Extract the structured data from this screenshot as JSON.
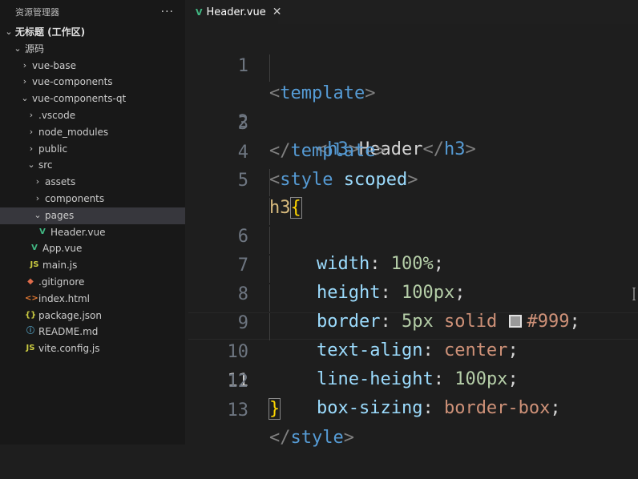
{
  "explorer": {
    "title": "资源管理器",
    "more": "···",
    "workspace": "无标题 (工作区)",
    "root_folder": "源码",
    "items": [
      {
        "label": "vue-base",
        "type": "folder",
        "expanded": false
      },
      {
        "label": "vue-components",
        "type": "folder",
        "expanded": false
      },
      {
        "label": "vue-components-qt",
        "type": "folder",
        "expanded": true
      },
      {
        "label": ".vscode",
        "type": "folder",
        "expanded": false
      },
      {
        "label": "node_modules",
        "type": "folder",
        "expanded": false
      },
      {
        "label": "public",
        "type": "folder",
        "expanded": false
      },
      {
        "label": "src",
        "type": "folder",
        "expanded": true
      },
      {
        "label": "assets",
        "type": "folder",
        "expanded": false
      },
      {
        "label": "components",
        "type": "folder",
        "expanded": false
      },
      {
        "label": "pages",
        "type": "folder",
        "expanded": true
      },
      {
        "label": "Header.vue",
        "type": "vue"
      },
      {
        "label": "App.vue",
        "type": "vue"
      },
      {
        "label": "main.js",
        "type": "js"
      },
      {
        "label": ".gitignore",
        "type": "git"
      },
      {
        "label": "index.html",
        "type": "html"
      },
      {
        "label": "package.json",
        "type": "json"
      },
      {
        "label": "README.md",
        "type": "info"
      },
      {
        "label": "vite.config.js",
        "type": "js"
      }
    ]
  },
  "icons": {
    "chevron_down": "chevron-down-icon",
    "chevron_right": "chevron-right-icon",
    "vue": "vue-file-icon",
    "js": "js-file-icon",
    "git": "git-file-icon",
    "html": "html-file-icon",
    "json": "json-file-icon",
    "info": "info-file-icon"
  },
  "icon_glyphs": {
    "chevron_down": "⌄",
    "chevron_right": "›",
    "vue": "V",
    "js": "JS",
    "git": "◆",
    "html": "<>",
    "json": "{}",
    "info": "ⓘ"
  },
  "tabs": [
    {
      "label": "Header.vue",
      "icon": "V",
      "close": "✕",
      "active": true
    }
  ],
  "editor": {
    "line_numbers": [
      "1",
      "2",
      "3",
      "4",
      "5",
      "6",
      "7",
      "8",
      "9",
      "10",
      "11",
      "12",
      "13"
    ],
    "current_line": "11",
    "swatch_color": "#999999",
    "tokens": {
      "l1_open": "<",
      "l1_tag": "template",
      "l1_close": ">",
      "l2_open": "<",
      "l2_tag": "h3",
      "l2_close": ">",
      "l2_text": "Header",
      "l2_end_open": "</",
      "l2_end_tag": "h3",
      "l2_end_close": ">",
      "l3_open": "</",
      "l3_tag": "template",
      "l3_close": ">",
      "l4_open": "<",
      "l4_tag": "style",
      "l4_attr": "scoped",
      "l4_close": ">",
      "l5_sel": "h3",
      "l5_brace": "{",
      "l6_prop": "width",
      "l6_colon": ": ",
      "l6_val": "100%",
      "l6_semi": ";",
      "l7_prop": "height",
      "l7_colon": ": ",
      "l7_val": "100px",
      "l7_semi": ";",
      "l8_prop": "border",
      "l8_colon": ": ",
      "l8_num": "5px",
      "l8_kw": "solid",
      "l8_hex": "#999",
      "l8_semi": ";",
      "l9_prop": "text-align",
      "l9_colon": ": ",
      "l9_val": "center",
      "l9_semi": ";",
      "l10_prop": "line-height",
      "l10_colon": ": ",
      "l10_val": "100px",
      "l10_semi": ";",
      "l11_prop": "box-sizing",
      "l11_colon": ": ",
      "l11_val": "border-box",
      "l11_semi": ";",
      "l12_brace": "}",
      "l13_open": "</",
      "l13_tag": "style",
      "l13_close": ">"
    }
  }
}
